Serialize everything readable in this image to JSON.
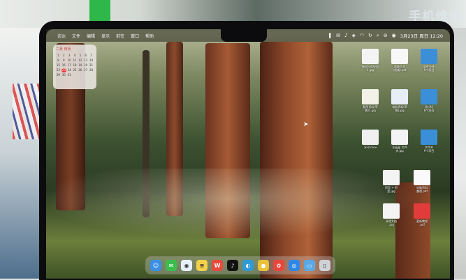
{
  "store": {
    "sign_text": "手机维修"
  },
  "menubar": {
    "apple_glyph": "",
    "items": [
      "访达",
      "文件",
      "编辑",
      "显示",
      "前往",
      "窗口",
      "帮助"
    ],
    "status_icons": [
      "stacks-icon",
      "wechat-icon",
      "tiktok-icon",
      "game-icon",
      "wifi-icon",
      "sync-icon",
      "search-icon",
      "toggle-icon",
      "siri-icon"
    ],
    "datetime": "3月23日 周日 12:20"
  },
  "calendar": {
    "title": "二月 日历",
    "days": [
      "1",
      "2",
      "3",
      "4",
      "5",
      "6",
      "7",
      "8",
      "9",
      "10",
      "11",
      "12",
      "13",
      "14",
      "15",
      "16",
      "17",
      "18",
      "19",
      "20",
      "21",
      "22",
      "23",
      "24",
      "25",
      "26",
      "27",
      "28",
      "29",
      "30",
      "31"
    ],
    "today": "23"
  },
  "desktop_files": [
    {
      "name": "Wechat0000\n1.jpg",
      "color": "#f4f4f4"
    },
    {
      "name": "超级大全\n(权威).pdf",
      "color": "#f8f8f8"
    },
    {
      "name": "软件分享\n9个项目",
      "color": "#3b8fd8"
    },
    {
      "name": "截图资料(草\n稿)1.jpg",
      "color": "#f2f2e8"
    },
    {
      "name": "电脑资料(草\n稿).jpg",
      "color": "#e8eef8"
    },
    {
      "name": "【技术】\n8个项目",
      "color": "#3b8fd8"
    },
    {
      "name": "水印.mov",
      "color": "#f0f0f0"
    },
    {
      "name": "水晶晶 文件\n夹.jpg",
      "color": "#f4f4f4"
    },
    {
      "name": "文件夹\n9个项目",
      "color": "#3b8fd8"
    },
    {
      "name": "阿里 + 阿\n里.jpg",
      "color": "#f4f4f4"
    },
    {
      "name": "电脑资料\n整理.pdf",
      "color": "#fafafa"
    },
    {
      "name": "说明文档\n.jpg",
      "color": "#f4f4f4"
    },
    {
      "name": "更新教程\n.pdf",
      "color": "#e23b3b"
    }
  ],
  "dock": [
    {
      "name": "finder-icon",
      "glyph": "☺",
      "color": "#3a8fe6"
    },
    {
      "name": "wechat-icon",
      "glyph": "✉",
      "color": "#3cbe4e"
    },
    {
      "name": "qq-icon",
      "glyph": "◉",
      "color": "#e8f0ff"
    },
    {
      "name": "notes-icon",
      "glyph": "≡",
      "color": "#f5d04a"
    },
    {
      "name": "wps-icon",
      "glyph": "W",
      "color": "#e84a3b"
    },
    {
      "name": "tiktok-icon",
      "glyph": "♪",
      "color": "#111111"
    },
    {
      "name": "edge-icon",
      "glyph": "◐",
      "color": "#2f9ad6"
    },
    {
      "name": "chrome-icon",
      "glyph": "●",
      "color": "#e9c23a"
    },
    {
      "name": "cluster-icon",
      "glyph": "✿",
      "color": "#e8463a"
    },
    {
      "name": "safari-icon",
      "glyph": "◎",
      "color": "#2e86e6"
    },
    {
      "name": "folder-icon",
      "glyph": "▭",
      "color": "#5aa8e6"
    },
    {
      "name": "trash-icon",
      "glyph": "▯",
      "color": "#cfd3d6"
    }
  ]
}
